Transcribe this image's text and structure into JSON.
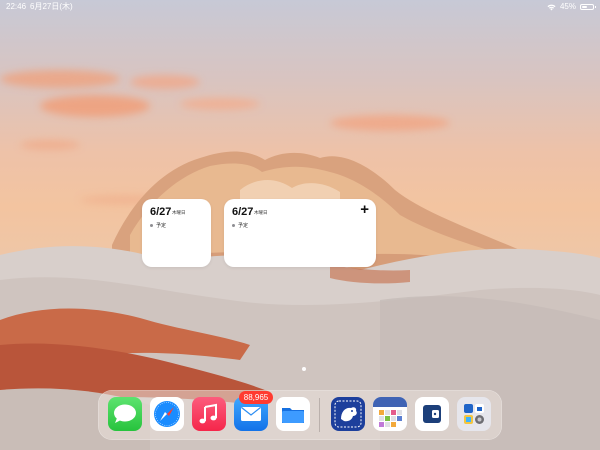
{
  "status_bar": {
    "time": "22:46",
    "date": "6月27日(木)",
    "battery": "45%",
    "battery_level": 0.45
  },
  "widgets": [
    {
      "date": "6/27",
      "weekday": "木曜日",
      "event": "予定"
    },
    {
      "date": "6/27",
      "weekday": "木曜日",
      "event": "予定",
      "add_symbol": "+"
    }
  ],
  "page_indicator": {
    "pages": 1,
    "current": 1
  },
  "dock": {
    "apps": [
      {
        "icon": "messages-icon",
        "color": "#34c759"
      },
      {
        "icon": "safari-icon",
        "color": "#1a8cff"
      },
      {
        "icon": "music-icon",
        "color": "#fa2d48"
      },
      {
        "icon": "mail-icon",
        "color": "#1e88f5",
        "badge": "88,965"
      },
      {
        "icon": "files-icon",
        "color": "#1f7ef0"
      },
      {
        "icon": "bird-app-icon",
        "color": "#1d3f9c"
      },
      {
        "icon": "calendar-grid-app-icon",
        "color": "#3f63b4"
      },
      {
        "icon": "wallet-app-icon",
        "color": "#1c3f7a"
      },
      {
        "icon": "app-folder-icon",
        "color": "#e8e8ee"
      }
    ]
  }
}
